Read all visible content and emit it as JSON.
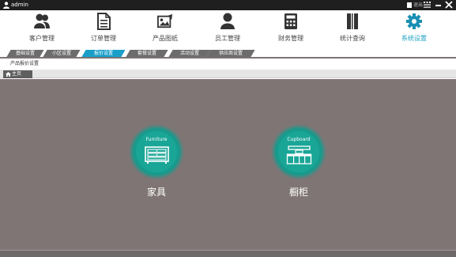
{
  "titlebar": {
    "user": "admin",
    "exit_label": "退出"
  },
  "nav": {
    "items": [
      {
        "label": "客户管理",
        "icon": "customers-icon"
      },
      {
        "label": "订单管理",
        "icon": "orders-icon"
      },
      {
        "label": "产品图纸",
        "icon": "product-drawings-icon"
      },
      {
        "label": "员工管理",
        "icon": "employee-icon"
      },
      {
        "label": "财务管理",
        "icon": "calculator-icon"
      },
      {
        "label": "统计查询",
        "icon": "statistics-icon"
      },
      {
        "label": "系统设置",
        "icon": "settings-gear-icon",
        "active": true
      }
    ]
  },
  "subtabs": [
    {
      "label": "基础设置"
    },
    {
      "label": "小区设置"
    },
    {
      "label": "报价设置",
      "active": true
    },
    {
      "label": "套餐设置"
    },
    {
      "label": "活动设置"
    },
    {
      "label": "供应商设置"
    }
  ],
  "breadcrumb": "产品报价设置",
  "home_tab": "主页",
  "cards": [
    {
      "caption": "Furniture",
      "label": "家具",
      "icon": "furniture-cabinet-icon"
    },
    {
      "caption": "Cupboard",
      "label": "橱柜",
      "icon": "cupboard-icon"
    }
  ],
  "colors": {
    "accent": "#1ea2c4",
    "card_teal": "#1aa697",
    "content_bg": "#807575"
  }
}
